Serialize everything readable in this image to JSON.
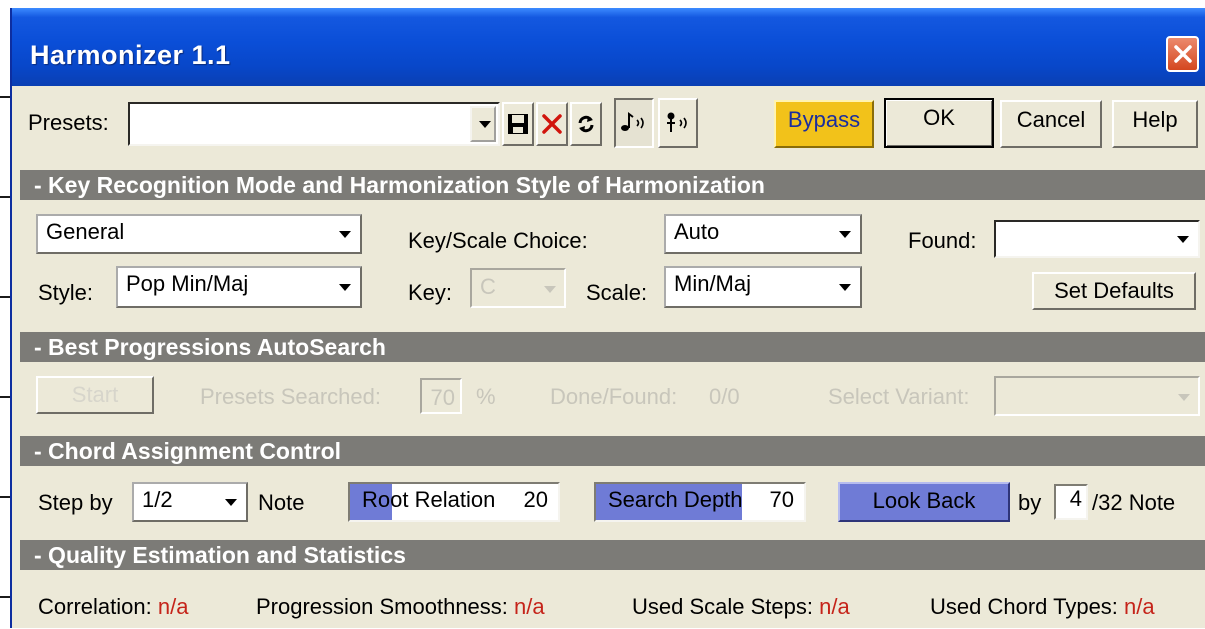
{
  "window": {
    "title": "Harmonizer 1.1"
  },
  "toolbar": {
    "presets_label": "Presets:",
    "presets_value": "",
    "bypass_label": "Bypass",
    "ok_label": "OK",
    "cancel_label": "Cancel",
    "help_label": "Help"
  },
  "sections": {
    "key_recognition": "- Key Recognition Mode and Harmonization Style of Harmonization",
    "autosearch": "- Best Progressions AutoSearch",
    "chord_assignment": "- Chord Assignment Control",
    "quality": "- Quality Estimation and Statistics"
  },
  "key_recognition": {
    "mode_value": "General",
    "key_scale_choice_label": "Key/Scale Choice:",
    "key_scale_choice_value": "Auto",
    "found_label": "Found:",
    "found_value": "",
    "style_label": "Style:",
    "style_value": "Pop Min/Maj",
    "key_label": "Key:",
    "key_value": "C",
    "scale_label": "Scale:",
    "scale_value": "Min/Maj",
    "set_defaults_label": "Set Defaults"
  },
  "autosearch": {
    "start_label": "Start",
    "presets_searched_label": "Presets Searched:",
    "presets_searched_value": "70",
    "percent": "%",
    "done_found_label": "Done/Found:",
    "done_found_value": "0/0",
    "select_variant_label": "Select Variant:",
    "select_variant_value": ""
  },
  "chord_assignment": {
    "step_by_label": "Step by",
    "step_value": "1/2",
    "note_label": "Note",
    "root_relation_label": "Root Relation",
    "root_relation_value": "20",
    "root_relation_level": 0.2,
    "search_depth_label": "Search Depth",
    "search_depth_value": "70",
    "search_depth_level": 0.7,
    "look_back_label": "Look Back",
    "by_label": "by",
    "by_value": "4",
    "by_suffix": "/32 Note"
  },
  "quality": {
    "correlation_label": "Correlation:",
    "correlation_value": "n/a",
    "smoothness_label": "Progression Smoothness:",
    "smoothness_value": "n/a",
    "scale_steps_label": "Used Scale Steps:",
    "scale_steps_value": "n/a",
    "chord_types_label": "Used Chord Types:",
    "chord_types_value": "n/a"
  },
  "colors": {
    "titlebar": "#0a4ed7",
    "section_header": "#7c7b77",
    "bypass": "#f2c21a",
    "slider_fill": "#6f7bd6",
    "value_red": "#c5241a"
  },
  "icons": [
    "close-icon",
    "dropdown-arrow-icon",
    "save-icon",
    "delete-icon",
    "refresh-icon",
    "note-listen-icon",
    "note-play-icon"
  ]
}
